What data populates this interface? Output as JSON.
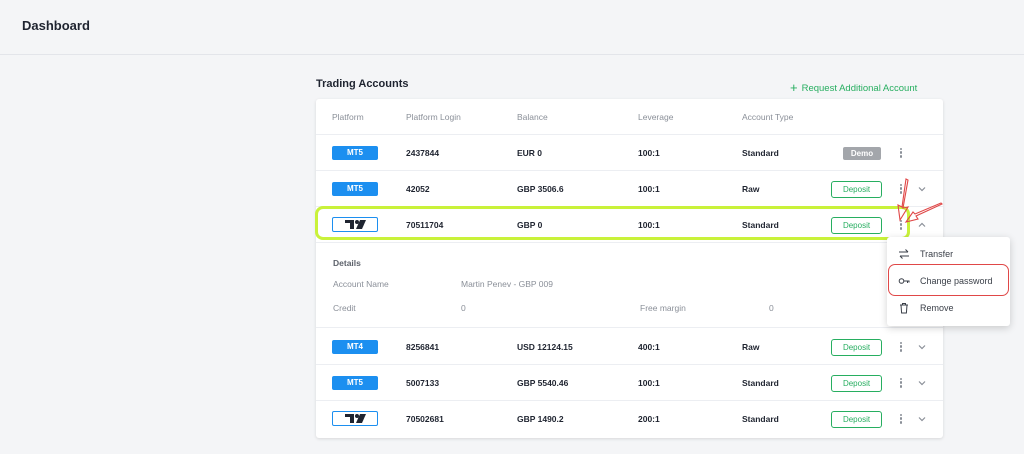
{
  "header": {
    "title": "Dashboard"
  },
  "section": {
    "title": "Trading Accounts",
    "request_label": "Request Additional Account"
  },
  "table": {
    "columns": [
      "Platform",
      "Platform Login",
      "Balance",
      "Leverage",
      "Account Type"
    ],
    "rows": [
      {
        "platform": "MT5",
        "login": "2437844",
        "balance": "EUR 0",
        "leverage": "100:1",
        "type": "Standard",
        "action": "Demo"
      },
      {
        "platform": "MT5",
        "login": "42052",
        "balance": "GBP 3506.6",
        "leverage": "100:1",
        "type": "Raw",
        "action": "Deposit"
      },
      {
        "platform": "TradingView",
        "login": "70511704",
        "balance": "GBP 0",
        "leverage": "100:1",
        "type": "Standard",
        "action": "Deposit"
      },
      {
        "platform": "MT4",
        "login": "8256841",
        "balance": "USD 12124.15",
        "leverage": "400:1",
        "type": "Raw",
        "action": "Deposit"
      },
      {
        "platform": "MT5",
        "login": "5007133",
        "balance": "GBP 5540.46",
        "leverage": "100:1",
        "type": "Standard",
        "action": "Deposit"
      },
      {
        "platform": "TradingView",
        "login": "70502681",
        "balance": "GBP 1490.2",
        "leverage": "200:1",
        "type": "Standard",
        "action": "Deposit"
      }
    ]
  },
  "details": {
    "title": "Details",
    "account_name_label": "Account Name",
    "account_name_value": "Martin Penev - GBP 009",
    "credit_label": "Credit",
    "credit_value": "0",
    "free_margin_label": "Free margin",
    "free_margin_value": "0"
  },
  "menu": {
    "items": [
      {
        "label": "Transfer",
        "icon": "transfer-icon"
      },
      {
        "label": "Change password",
        "icon": "key-icon"
      },
      {
        "label": "Remove",
        "icon": "trash-icon"
      }
    ]
  },
  "colors": {
    "accent_green": "#27ae60",
    "badge_blue": "#1c8ff0",
    "highlight": "#c9f23a",
    "annotation_red": "#e04848"
  }
}
